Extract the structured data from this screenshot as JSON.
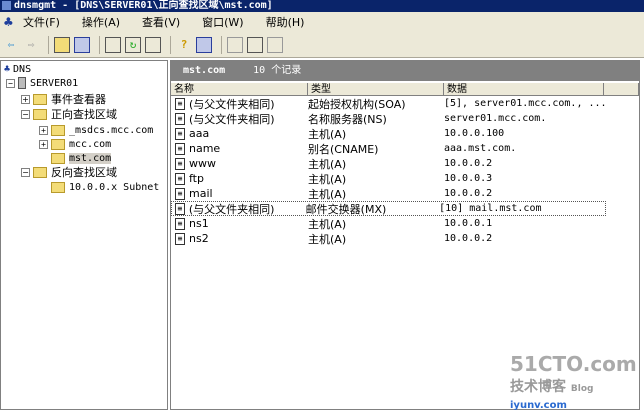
{
  "window": {
    "title": "dnsmgmt - [DNS\\SERVER01\\正向查找区域\\mst.com]"
  },
  "menu": [
    {
      "label": "文件(F)"
    },
    {
      "label": "操作(A)"
    },
    {
      "label": "查看(V)"
    },
    {
      "label": "窗口(W)"
    },
    {
      "label": "帮助(H)"
    }
  ],
  "tree": {
    "root": "DNS",
    "server": "SERVER01",
    "event_viewer": "事件查看器",
    "forward_zones": "正向查找区域",
    "zones": [
      "_msdcs.mcc.com",
      "mcc.com",
      "mst.com"
    ],
    "reverse_zones": "反向查找区域",
    "reverse": [
      "10.0.0.x Subnet"
    ]
  },
  "pane": {
    "zone": "mst.com",
    "count": "10 个记录",
    "columns": [
      "名称",
      "类型",
      "数据"
    ],
    "rows": [
      {
        "name": "(与父文件夹相同)",
        "type": "起始授权机构(SOA)",
        "data": "[5], server01.mcc.com., ..."
      },
      {
        "name": "(与父文件夹相同)",
        "type": "名称服务器(NS)",
        "data": "server01.mcc.com."
      },
      {
        "name": "aaa",
        "type": "主机(A)",
        "data": "10.0.0.100"
      },
      {
        "name": "name",
        "type": "别名(CNAME)",
        "data": "aaa.mst.com."
      },
      {
        "name": "www",
        "type": "主机(A)",
        "data": "10.0.0.2"
      },
      {
        "name": "ftp",
        "type": "主机(A)",
        "data": "10.0.0.3"
      },
      {
        "name": "mail",
        "type": "主机(A)",
        "data": "10.0.0.2"
      },
      {
        "name": "(与父文件夹相同)",
        "type": "邮件交换器(MX)",
        "data": "[10] mail.mst.com"
      },
      {
        "name": "ns1",
        "type": "主机(A)",
        "data": "10.0.0.1"
      },
      {
        "name": "ns2",
        "type": "主机(A)",
        "data": "10.0.0.2"
      }
    ]
  },
  "watermark": {
    "line1": "51CTO.com",
    "line2": "技术博客",
    "line3": "Blog",
    "line4": "iyunv.com"
  }
}
